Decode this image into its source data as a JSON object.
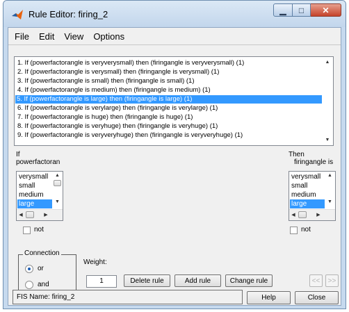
{
  "window": {
    "title": "Rule Editor: firing_2"
  },
  "menu": [
    "File",
    "Edit",
    "View",
    "Options"
  ],
  "rules": [
    "1. If (powerfactorangle is veryverysmall) then (firingangle is veryverysmall) (1)",
    "2. If (powerfactorangle is verysmall) then (firingangle is verysmall) (1)",
    "3. If (powerfactorangle is small) then (firingangle is small) (1)",
    "4. If (powerfactorangle is medium) then (firingangle is medium) (1)",
    "5. If (powerfactorangle is large) then (firingangle is large) (1)",
    "6. If (powerfactorangle is verylarge) then (firingangle is verylarge) (1)",
    "7. If (powerfactorangle is huge) then (firingangle is huge) (1)",
    "8. If (powerfactorangle is veryhuge) then (firingangle is veryhuge) (1)",
    "9. If (powerfactorangle is veryveryhuge) then (firingangle is veryveryhuge) (1)"
  ],
  "selected_rule_index": 4,
  "input": {
    "if_label": "If",
    "variable_label": "powerfactoran",
    "items": [
      "verysmall",
      "small",
      "medium",
      "large"
    ],
    "selected": "large",
    "not_label": "not",
    "not_checked": false
  },
  "output": {
    "then_label": "Then",
    "variable_label": "firingangle is",
    "items": [
      "verysmall",
      "small",
      "medium",
      "large"
    ],
    "selected": "large",
    "not_label": "not",
    "not_checked": false
  },
  "connection": {
    "title": "Connection",
    "options": [
      "or",
      "and"
    ],
    "selected": "or"
  },
  "weight": {
    "label": "Weight:",
    "value": "1"
  },
  "buttons": {
    "delete": "Delete rule",
    "add": "Add rule",
    "change": "Change rule",
    "prev": "<<",
    "next": ">>"
  },
  "status": {
    "text": "FIS Name: firing_2"
  },
  "footer": {
    "help": "Help",
    "close": "Close"
  }
}
